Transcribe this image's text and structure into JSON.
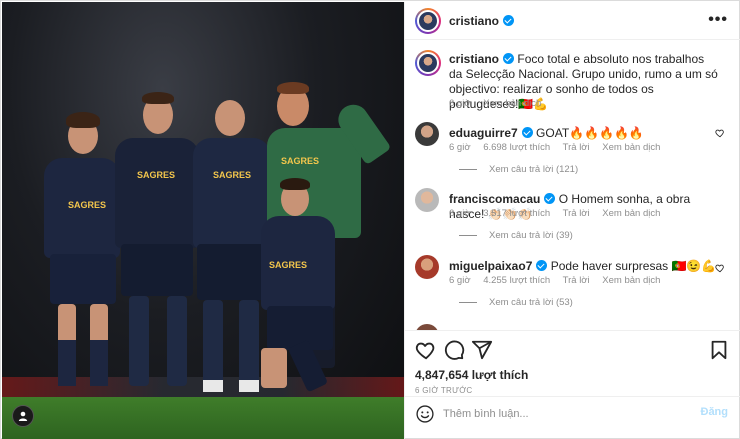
{
  "post": {
    "username": "cristiano",
    "more_label": "•••",
    "caption": {
      "username": "cristiano",
      "text": "Foco total e absoluto nos trabalhos da Selecção Nacional. Grupo unido, rumo a um só objectivo: realizar o sonho de todos os portugueses!🇵🇹💪",
      "time": "6 giờ",
      "translate": "Xem bản dịch"
    }
  },
  "comments": [
    {
      "username": "eduaguirre7",
      "text": "GOAT🔥🔥🔥🔥🔥",
      "time": "6 giờ",
      "likes": "6.698 lượt thích",
      "reply": "Trả lời",
      "translate": "Xem bản dịch",
      "replies": "Xem câu trả lời (121)"
    },
    {
      "username": "franciscomacau",
      "text": "O Homem sonha, a obra nasce! 👏🏻👏🏻👏🏻",
      "time": "6 giờ",
      "likes": "3.517 lượt thích",
      "reply": "Trả lời",
      "translate": "Xem bản dịch",
      "replies": "Xem câu trả lời (39)"
    },
    {
      "username": "miguelpaixao7",
      "text": "Pode haver surpresas 🇵🇹😉💪",
      "time": "6 giờ",
      "likes": "4.255 lượt thích",
      "reply": "Trả lời",
      "translate": "Xem bản dịch",
      "replies": "Xem câu trả lời (53)"
    }
  ],
  "actions": {
    "likes": "4,847,654 lượt thích",
    "time_ago": "6 GIỜ TRƯỚC"
  },
  "compose": {
    "placeholder": "Thêm bình luận...",
    "post_label": "Đăng"
  },
  "photo": {
    "sponsor_text": "SAGRES"
  },
  "colors": {
    "verified": "#0095f6",
    "secondary_text": "#8e8e8e",
    "post_disabled": "#b2dffc",
    "heart": "#ed4956"
  },
  "icons": [
    "verified-badge-icon",
    "more-options-icon",
    "heart-icon",
    "comment-icon",
    "share-icon",
    "bookmark-icon",
    "emoji-icon",
    "user-tag-icon"
  ]
}
